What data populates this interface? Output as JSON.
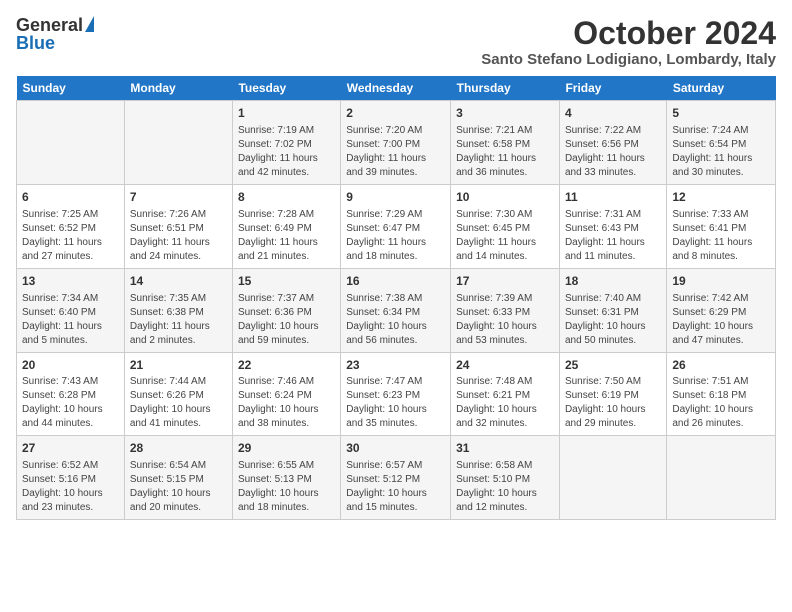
{
  "header": {
    "logo_general": "General",
    "logo_blue": "Blue",
    "month_title": "October 2024",
    "location": "Santo Stefano Lodigiano, Lombardy, Italy"
  },
  "weekdays": [
    "Sunday",
    "Monday",
    "Tuesday",
    "Wednesday",
    "Thursday",
    "Friday",
    "Saturday"
  ],
  "weeks": [
    [
      {
        "day": "",
        "info": ""
      },
      {
        "day": "",
        "info": ""
      },
      {
        "day": "1",
        "info": "Sunrise: 7:19 AM\nSunset: 7:02 PM\nDaylight: 11 hours and 42 minutes."
      },
      {
        "day": "2",
        "info": "Sunrise: 7:20 AM\nSunset: 7:00 PM\nDaylight: 11 hours and 39 minutes."
      },
      {
        "day": "3",
        "info": "Sunrise: 7:21 AM\nSunset: 6:58 PM\nDaylight: 11 hours and 36 minutes."
      },
      {
        "day": "4",
        "info": "Sunrise: 7:22 AM\nSunset: 6:56 PM\nDaylight: 11 hours and 33 minutes."
      },
      {
        "day": "5",
        "info": "Sunrise: 7:24 AM\nSunset: 6:54 PM\nDaylight: 11 hours and 30 minutes."
      }
    ],
    [
      {
        "day": "6",
        "info": "Sunrise: 7:25 AM\nSunset: 6:52 PM\nDaylight: 11 hours and 27 minutes."
      },
      {
        "day": "7",
        "info": "Sunrise: 7:26 AM\nSunset: 6:51 PM\nDaylight: 11 hours and 24 minutes."
      },
      {
        "day": "8",
        "info": "Sunrise: 7:28 AM\nSunset: 6:49 PM\nDaylight: 11 hours and 21 minutes."
      },
      {
        "day": "9",
        "info": "Sunrise: 7:29 AM\nSunset: 6:47 PM\nDaylight: 11 hours and 18 minutes."
      },
      {
        "day": "10",
        "info": "Sunrise: 7:30 AM\nSunset: 6:45 PM\nDaylight: 11 hours and 14 minutes."
      },
      {
        "day": "11",
        "info": "Sunrise: 7:31 AM\nSunset: 6:43 PM\nDaylight: 11 hours and 11 minutes."
      },
      {
        "day": "12",
        "info": "Sunrise: 7:33 AM\nSunset: 6:41 PM\nDaylight: 11 hours and 8 minutes."
      }
    ],
    [
      {
        "day": "13",
        "info": "Sunrise: 7:34 AM\nSunset: 6:40 PM\nDaylight: 11 hours and 5 minutes."
      },
      {
        "day": "14",
        "info": "Sunrise: 7:35 AM\nSunset: 6:38 PM\nDaylight: 11 hours and 2 minutes."
      },
      {
        "day": "15",
        "info": "Sunrise: 7:37 AM\nSunset: 6:36 PM\nDaylight: 10 hours and 59 minutes."
      },
      {
        "day": "16",
        "info": "Sunrise: 7:38 AM\nSunset: 6:34 PM\nDaylight: 10 hours and 56 minutes."
      },
      {
        "day": "17",
        "info": "Sunrise: 7:39 AM\nSunset: 6:33 PM\nDaylight: 10 hours and 53 minutes."
      },
      {
        "day": "18",
        "info": "Sunrise: 7:40 AM\nSunset: 6:31 PM\nDaylight: 10 hours and 50 minutes."
      },
      {
        "day": "19",
        "info": "Sunrise: 7:42 AM\nSunset: 6:29 PM\nDaylight: 10 hours and 47 minutes."
      }
    ],
    [
      {
        "day": "20",
        "info": "Sunrise: 7:43 AM\nSunset: 6:28 PM\nDaylight: 10 hours and 44 minutes."
      },
      {
        "day": "21",
        "info": "Sunrise: 7:44 AM\nSunset: 6:26 PM\nDaylight: 10 hours and 41 minutes."
      },
      {
        "day": "22",
        "info": "Sunrise: 7:46 AM\nSunset: 6:24 PM\nDaylight: 10 hours and 38 minutes."
      },
      {
        "day": "23",
        "info": "Sunrise: 7:47 AM\nSunset: 6:23 PM\nDaylight: 10 hours and 35 minutes."
      },
      {
        "day": "24",
        "info": "Sunrise: 7:48 AM\nSunset: 6:21 PM\nDaylight: 10 hours and 32 minutes."
      },
      {
        "day": "25",
        "info": "Sunrise: 7:50 AM\nSunset: 6:19 PM\nDaylight: 10 hours and 29 minutes."
      },
      {
        "day": "26",
        "info": "Sunrise: 7:51 AM\nSunset: 6:18 PM\nDaylight: 10 hours and 26 minutes."
      }
    ],
    [
      {
        "day": "27",
        "info": "Sunrise: 6:52 AM\nSunset: 5:16 PM\nDaylight: 10 hours and 23 minutes."
      },
      {
        "day": "28",
        "info": "Sunrise: 6:54 AM\nSunset: 5:15 PM\nDaylight: 10 hours and 20 minutes."
      },
      {
        "day": "29",
        "info": "Sunrise: 6:55 AM\nSunset: 5:13 PM\nDaylight: 10 hours and 18 minutes."
      },
      {
        "day": "30",
        "info": "Sunrise: 6:57 AM\nSunset: 5:12 PM\nDaylight: 10 hours and 15 minutes."
      },
      {
        "day": "31",
        "info": "Sunrise: 6:58 AM\nSunset: 5:10 PM\nDaylight: 10 hours and 12 minutes."
      },
      {
        "day": "",
        "info": ""
      },
      {
        "day": "",
        "info": ""
      }
    ]
  ]
}
